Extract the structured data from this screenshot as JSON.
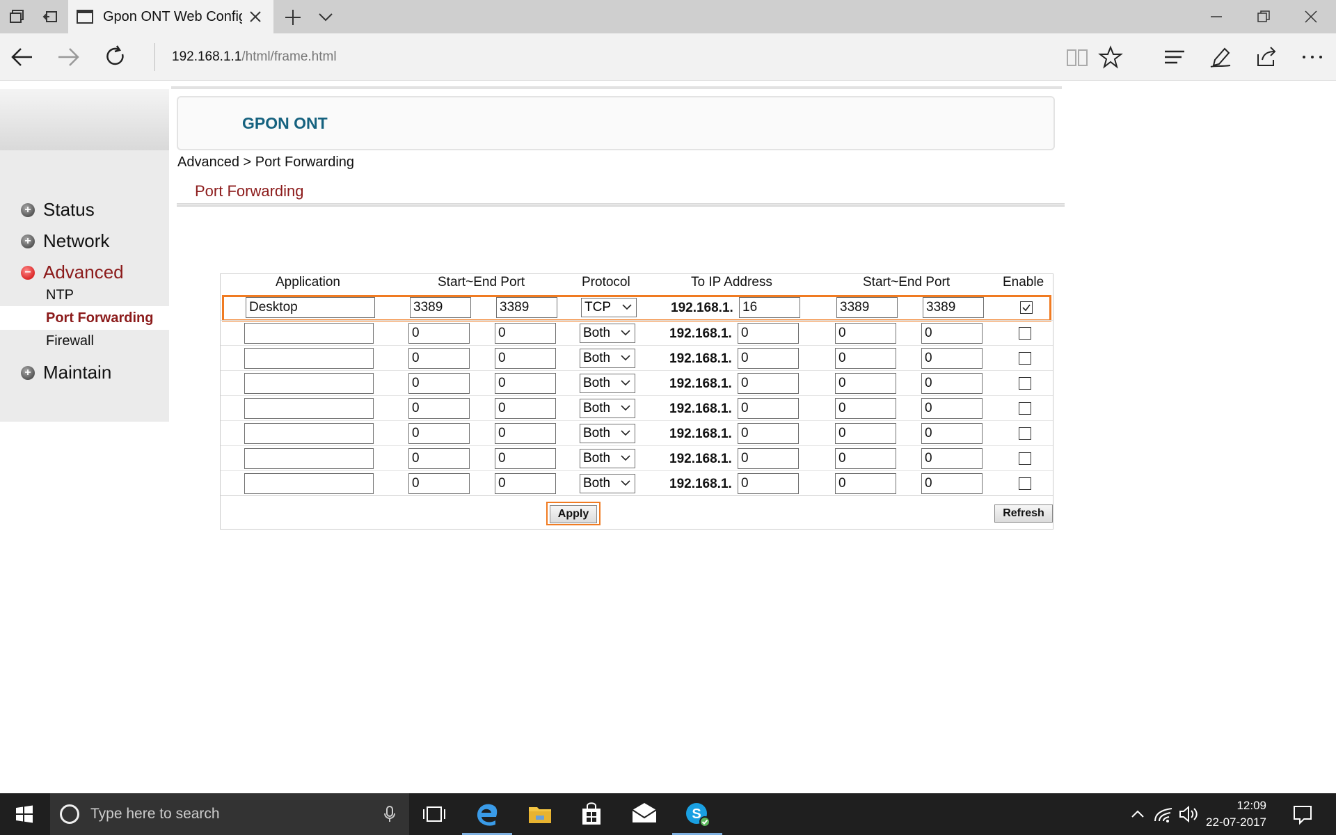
{
  "browser": {
    "tab_title": "Gpon ONT Web Configu",
    "address_host": "192.168.1.1",
    "address_path": "/html/frame.html"
  },
  "page": {
    "brand": "GPON ONT",
    "breadcrumb": "Advanced > Port Forwarding",
    "heading": "Port Forwarding"
  },
  "menu": {
    "status": "Status",
    "network": "Network",
    "advanced": "Advanced",
    "ntp": "NTP",
    "port_forwarding": "Port Forwarding",
    "firewall": "Firewall",
    "maintain": "Maintain"
  },
  "table": {
    "headers": [
      "Application",
      "Start~End Port",
      "Protocol",
      "To IP Address",
      "Start~End Port",
      "Enable"
    ],
    "ip_prefix": "192.168.1.",
    "rows": [
      {
        "app": "Desktop",
        "start": "3389",
        "end": "3389",
        "protocol": "TCP",
        "ip": "16",
        "to_start": "3389",
        "to_end": "3389",
        "enabled": true
      },
      {
        "app": "",
        "start": "0",
        "end": "0",
        "protocol": "Both",
        "ip": "0",
        "to_start": "0",
        "to_end": "0",
        "enabled": false
      },
      {
        "app": "",
        "start": "0",
        "end": "0",
        "protocol": "Both",
        "ip": "0",
        "to_start": "0",
        "to_end": "0",
        "enabled": false
      },
      {
        "app": "",
        "start": "0",
        "end": "0",
        "protocol": "Both",
        "ip": "0",
        "to_start": "0",
        "to_end": "0",
        "enabled": false
      },
      {
        "app": "",
        "start": "0",
        "end": "0",
        "protocol": "Both",
        "ip": "0",
        "to_start": "0",
        "to_end": "0",
        "enabled": false
      },
      {
        "app": "",
        "start": "0",
        "end": "0",
        "protocol": "Both",
        "ip": "0",
        "to_start": "0",
        "to_end": "0",
        "enabled": false
      },
      {
        "app": "",
        "start": "0",
        "end": "0",
        "protocol": "Both",
        "ip": "0",
        "to_start": "0",
        "to_end": "0",
        "enabled": false
      },
      {
        "app": "",
        "start": "0",
        "end": "0",
        "protocol": "Both",
        "ip": "0",
        "to_start": "0",
        "to_end": "0",
        "enabled": false
      }
    ],
    "apply_label": "Apply",
    "refresh_label": "Refresh"
  },
  "taskbar": {
    "search_placeholder": "Type here to search",
    "time": "12:09",
    "date": "22-07-2017"
  },
  "colors": {
    "accent_red": "#8b1a1a",
    "brand_blue": "#16627f",
    "highlight_orange": "#f07b22"
  }
}
